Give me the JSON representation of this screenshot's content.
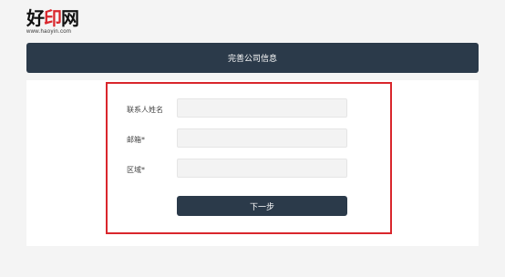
{
  "logo": {
    "text_main": "好",
    "text_accent": "印",
    "text_end": "网",
    "url": "www.haoyin.com"
  },
  "header": {
    "title": "完善公司信息"
  },
  "form": {
    "contact_label": "联系人姓名",
    "contact_value": "",
    "email_label": "邮箱*",
    "email_value": "",
    "region_label": "区域*",
    "region_value": "",
    "next_label": "下一步"
  },
  "colors": {
    "header_bg": "#2b3a4a",
    "highlight": "#d9262c"
  }
}
